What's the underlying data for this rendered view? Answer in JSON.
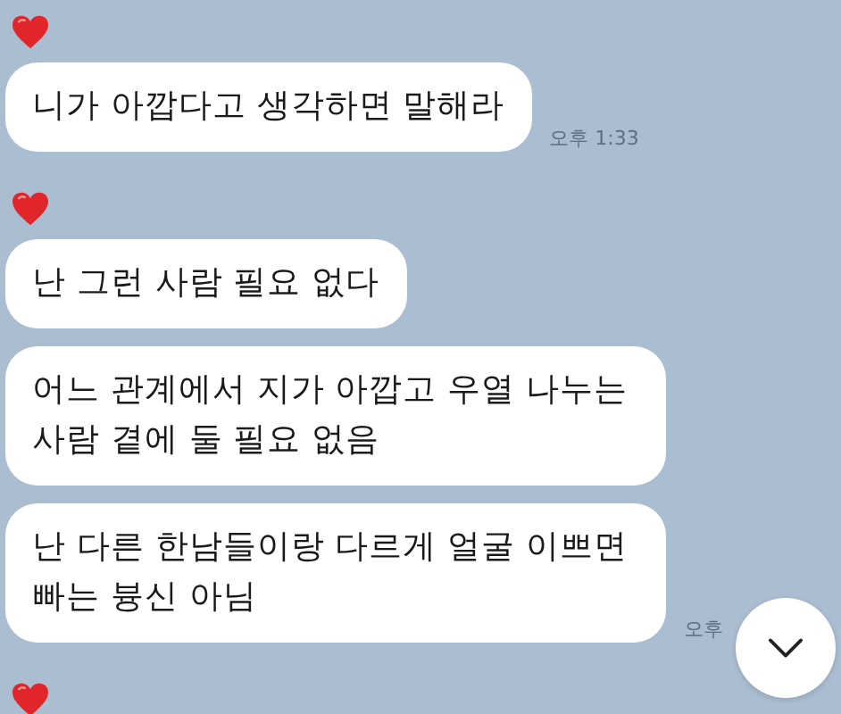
{
  "messages": [
    {
      "heart": true,
      "text": "니가 아깝다고 생각하면 말해라",
      "time": "오후 1:33"
    },
    {
      "heart": true,
      "text": "난 그런 사람 필요 없다"
    },
    {
      "heart": false,
      "text": "어느 관계에서 지가 아깝고 우열 나누는 사람 곁에 둘 필요 없음"
    },
    {
      "heart": false,
      "text": "난 다른 한남들이랑 다르게 얼굴 이쁘면 빠는 븅신 아님",
      "time": "오후"
    },
    {
      "heart": true
    }
  ]
}
